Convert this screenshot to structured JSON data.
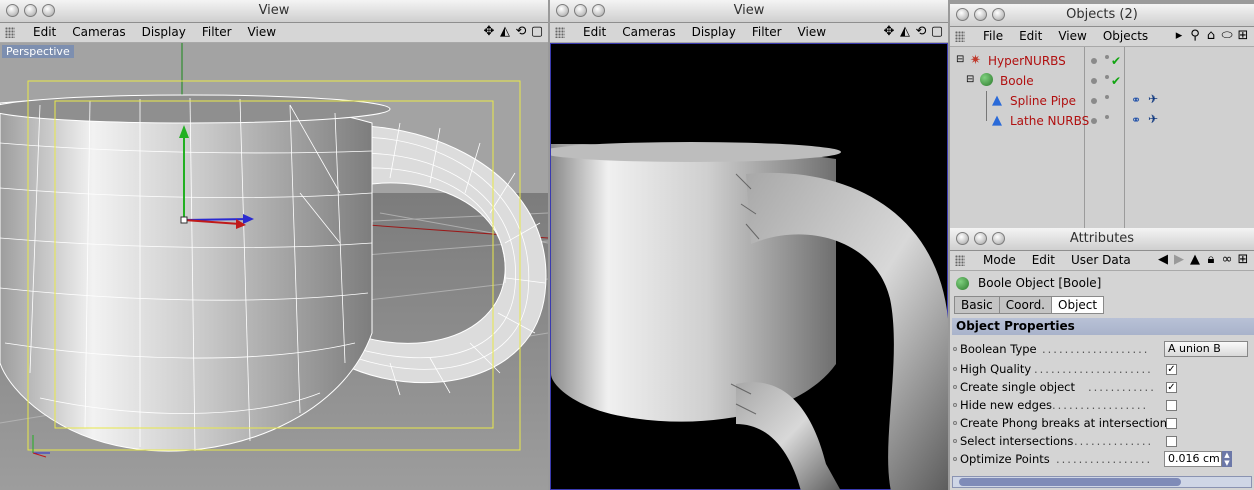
{
  "view1": {
    "title": "View",
    "menus": [
      "Edit",
      "Cameras",
      "Display",
      "Filter",
      "View"
    ],
    "viewport_label": "Perspective"
  },
  "view2": {
    "title": "View",
    "menus": [
      "Edit",
      "Cameras",
      "Display",
      "Filter",
      "View"
    ]
  },
  "objects": {
    "title": "Objects (2)",
    "menus": [
      "File",
      "Edit",
      "View",
      "Objects"
    ],
    "items": [
      {
        "name": "HyperNURBS",
        "depth": 0,
        "expanded": true,
        "checked": true
      },
      {
        "name": "Boole",
        "depth": 1,
        "expanded": true,
        "checked": true
      },
      {
        "name": "Spline Pipe",
        "depth": 2,
        "checked": false
      },
      {
        "name": "Lathe NURBS",
        "depth": 2,
        "checked": false
      }
    ]
  },
  "attributes": {
    "title": "Attributes",
    "menus": [
      "Mode",
      "Edit",
      "User Data"
    ],
    "object_title": "Boole Object [Boole]",
    "tabs": [
      "Basic",
      "Coord.",
      "Object"
    ],
    "active_tab": "Object",
    "section": "Object Properties",
    "properties": [
      {
        "label": "Boolean Type",
        "type": "select",
        "value": "A union B"
      },
      {
        "label": "High Quality",
        "type": "checkbox",
        "checked": true
      },
      {
        "label": "Create single object",
        "type": "checkbox",
        "checked": true
      },
      {
        "label": "Hide new edges",
        "type": "checkbox",
        "checked": false
      },
      {
        "label": "Create Phong breaks at intersections",
        "type": "checkbox",
        "checked": false
      },
      {
        "label": "Select intersections",
        "type": "checkbox",
        "checked": false
      },
      {
        "label": "Optimize Points",
        "type": "number",
        "value": "0.016 cm"
      }
    ]
  },
  "colors": {
    "wire": "#ffffff",
    "safe_frame": "#e8e84a",
    "object_name": "#b01010",
    "check": "#11a511",
    "section_header": "#aeb8cf"
  }
}
